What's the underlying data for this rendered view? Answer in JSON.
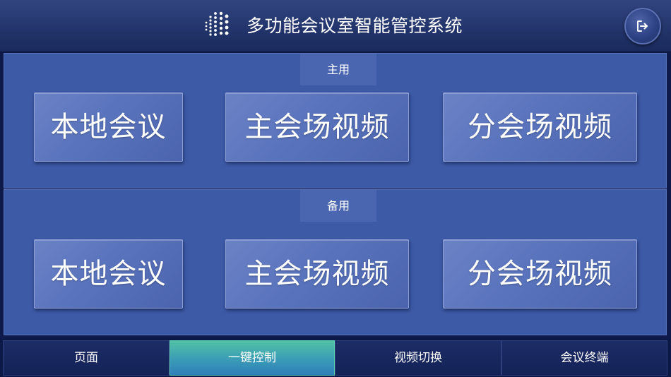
{
  "header": {
    "title": "多功能会议室智能管控系统",
    "logo_icon": "dot-grid-logo-icon",
    "exit_icon": "logout-icon"
  },
  "sections": {
    "main": {
      "label": "主用",
      "buttons": [
        "本地会议",
        "主会场视频",
        "分会场视频"
      ]
    },
    "backup": {
      "label": "备用",
      "buttons": [
        "本地会议",
        "主会场视频",
        "分会场视频"
      ]
    }
  },
  "tabs": [
    {
      "label": "页面",
      "active": false
    },
    {
      "label": "一键控制",
      "active": true
    },
    {
      "label": "视频切换",
      "active": false
    },
    {
      "label": "会议终端",
      "active": false
    }
  ],
  "colors": {
    "panel": "#3d5aa6",
    "header": "#23356c",
    "active_tab_top": "#52c2a6",
    "active_tab_bottom": "#2f7fb8"
  }
}
